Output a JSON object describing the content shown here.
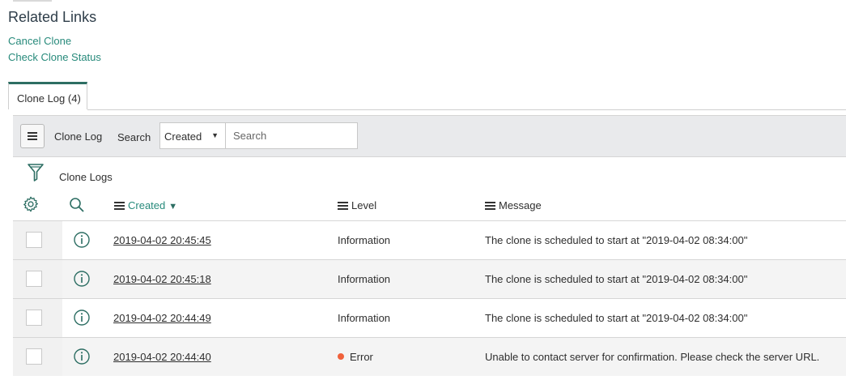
{
  "related_links": {
    "title": "Related Links",
    "links": [
      "Cancel Clone",
      "Check Clone Status"
    ]
  },
  "tab": {
    "label": "Clone Log (4)"
  },
  "toolbar": {
    "title": "Clone Log",
    "search_label": "Search",
    "field_select": "Created",
    "search_placeholder": "Search"
  },
  "breadcrumb": "Clone Logs",
  "columns": {
    "created": "Created",
    "level": "Level",
    "message": "Message"
  },
  "colors": {
    "link": "#278a7b",
    "error_dot": "#f0613b",
    "tab_accent": "#2d6e63"
  },
  "rows": [
    {
      "created": "2019-04-02 20:45:45",
      "level": "Information",
      "level_status": "info",
      "message": "The clone is scheduled to start at \"2019-04-02 08:34:00\""
    },
    {
      "created": "2019-04-02 20:45:18",
      "level": "Information",
      "level_status": "info",
      "message": "The clone is scheduled to start at \"2019-04-02 08:34:00\""
    },
    {
      "created": "2019-04-02 20:44:49",
      "level": "Information",
      "level_status": "info",
      "message": "The clone is scheduled to start at \"2019-04-02 08:34:00\""
    },
    {
      "created": "2019-04-02 20:44:40",
      "level": "Error",
      "level_status": "error",
      "message": "Unable to contact server for confirmation. Please check the server URL."
    }
  ]
}
